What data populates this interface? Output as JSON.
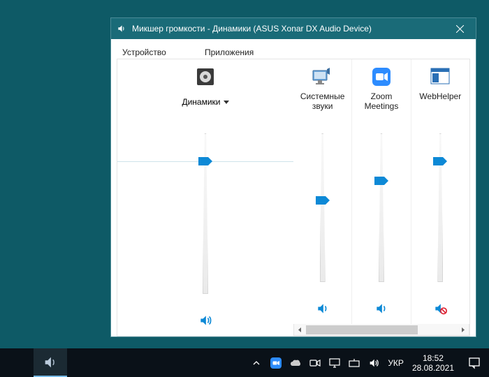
{
  "window": {
    "title": "Микшер громкости - Динамики (ASUS Xonar DX Audio Device)"
  },
  "section_headers": {
    "device": "Устройство",
    "applications": "Приложения"
  },
  "device": {
    "label": "Динамики",
    "volume_percent": 74,
    "muted": false
  },
  "apps": [
    {
      "name": "Системные звуки",
      "volume_percent": 38,
      "muted": false,
      "icon": "system-sounds"
    },
    {
      "name": "Zoom Meetings",
      "volume_percent": 56,
      "muted": false,
      "icon": "zoom"
    },
    {
      "name": "WebHelper",
      "volume_percent": 74,
      "muted": true,
      "icon": "webhelper"
    }
  ],
  "taskbar": {
    "language": "УКР",
    "clock_time": "18:52",
    "clock_date": "28.08.2021"
  },
  "colors": {
    "desktop": "#0e5a66",
    "titlebar": "#1a6b78",
    "accent": "#0d89d6"
  }
}
